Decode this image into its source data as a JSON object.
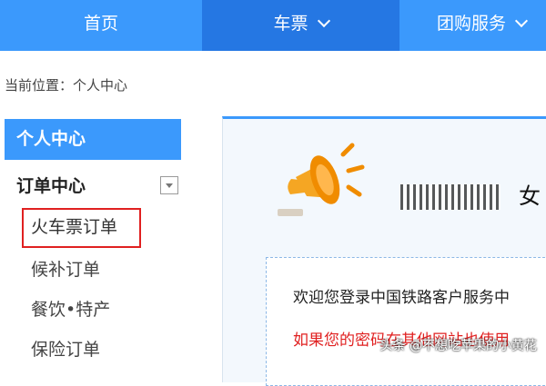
{
  "nav": {
    "home": "首页",
    "tickets": "车票",
    "group": "团购服务"
  },
  "breadcrumb": "当前位置：个人中心",
  "sidebar": {
    "header": "个人中心",
    "category": "订单中心",
    "items": [
      {
        "label": "火车票订单"
      },
      {
        "label": "候补订单"
      },
      {
        "label": "餐饮•特产"
      },
      {
        "label": "保险订单"
      }
    ]
  },
  "main": {
    "title_suffix": "女",
    "welcome": "欢迎您登录中国铁路客户服务中",
    "warning": "如果您的密码在其他网站也使用"
  },
  "watermark": "头条 @不想吃苹果的小黄花",
  "colors": {
    "nav_bg": "#3b99fc",
    "nav_active": "#2577e3",
    "highlight_border": "#e02020",
    "warning": "#e02020"
  }
}
